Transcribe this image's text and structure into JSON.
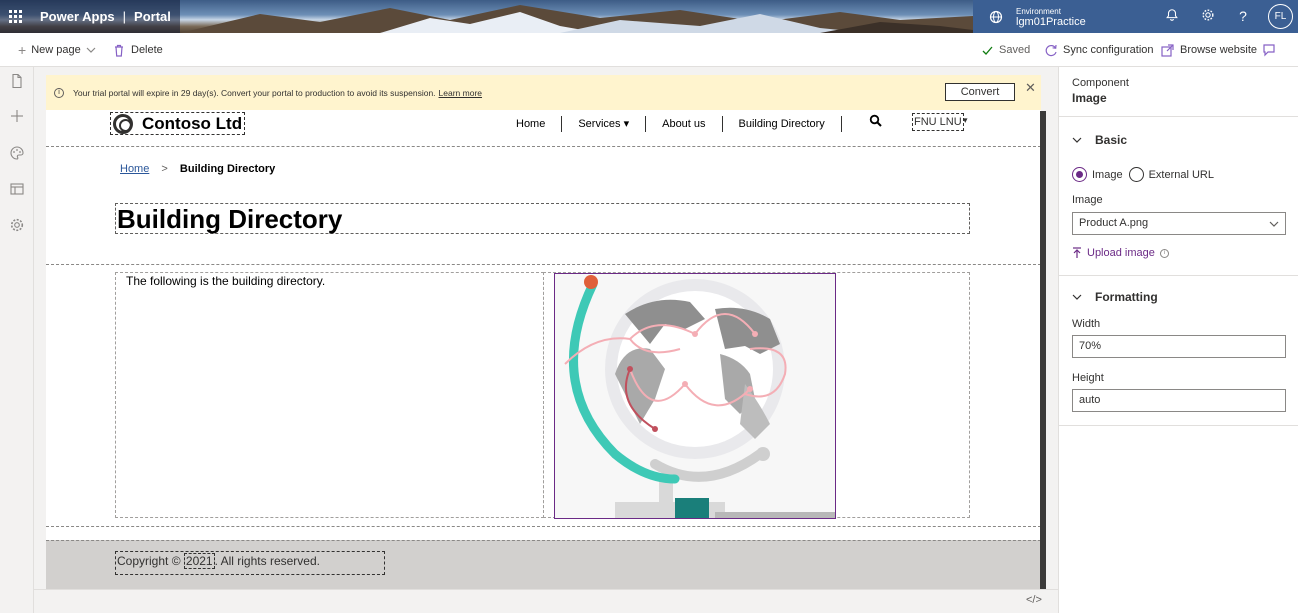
{
  "header": {
    "app_name": "Power Apps",
    "separator": "|",
    "app_section": "Portal",
    "environment_label": "Environment",
    "environment_name": "lgm01Practice",
    "user_initials": "FL"
  },
  "toolbar": {
    "new_page": "New page",
    "delete": "Delete",
    "saved": "Saved",
    "sync": "Sync configuration",
    "browse": "Browse website"
  },
  "notice": {
    "message": "Your trial portal will expire in 29 day(s). Convert your portal to production to avoid its suspension.",
    "link": "Learn more",
    "convert_label": "Convert"
  },
  "site": {
    "brand": "Contoso Ltd",
    "nav": [
      "Home",
      "Services",
      "About us",
      "Building Directory"
    ],
    "user": "FNU LNU"
  },
  "breadcrumb": {
    "home": "Home",
    "separator": ">",
    "current": "Building Directory"
  },
  "content": {
    "title": "Building Directory",
    "body": "The following is the building directory."
  },
  "footer": {
    "prefix": "Copyright ©",
    "year": "2021",
    "suffix": ". All rights reserved."
  },
  "panel": {
    "component_label": "Component",
    "component_value": "Image",
    "basic_title": "Basic",
    "radio_image": "Image",
    "radio_external": "External URL",
    "image_label": "Image",
    "image_value": "Product A.png",
    "upload_label": "Upload image",
    "formatting_title": "Formatting",
    "width_label": "Width",
    "width_value": "70%",
    "height_label": "Height",
    "height_value": "auto"
  },
  "colors": {
    "accent": "#6b2a86",
    "notice_bg": "#fff4ce",
    "footer_bg": "#d2d0ce"
  },
  "icons": [
    "waffle-icon",
    "globe-icon",
    "bell-icon",
    "settings-icon",
    "help-icon",
    "plus-icon",
    "chevron-down-icon",
    "trash-icon",
    "check-icon",
    "sync-icon",
    "external-link-icon",
    "feedback-icon",
    "page-icon",
    "add-icon",
    "theme-icon",
    "template-icon",
    "gear-icon",
    "info-icon",
    "close-icon",
    "search-icon",
    "code-icon"
  ]
}
